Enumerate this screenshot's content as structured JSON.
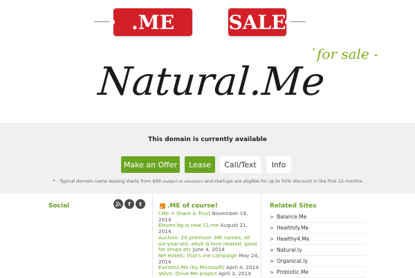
{
  "header": {
    "tags": [
      ".ME",
      "SALE"
    ],
    "domain": "Natural.Me",
    "for_sale": "for sale"
  },
  "offer": {
    "status": "This domain is currently available",
    "buttons": {
      "make_offer": "Make an Offer",
      "lease": "Lease",
      "call": "Call/Text",
      "info": "Info"
    },
    "note_prefix": "* - Typical domain name leasing starts from $99",
    "note_small": "(subject to valuation)",
    "note_suffix": "and startups are eligible for up to 50% discount in the first 12 months"
  },
  "social": {
    "heading": "Social",
    "icons": [
      "rss-icon",
      "facebook-icon",
      "twitter-icon"
    ]
  },
  "news": {
    "heading": ".ME of course!",
    "items": [
      {
        "title": "I.Me = Share & Trust",
        "date": "November 19, 2014"
      },
      {
        "title": "Eleven.bg is now 11.me",
        "date": "August 21, 2014"
      },
      {
        "title": "Auction: 24 premium .ME names, all six-year-old, adult & love related, good for shops etc",
        "date": "June 4, 2014"
      },
      {
        "title": "NH Hotels: that's me campaign",
        "date": "May 24, 2014"
      },
      {
        "title": "Eventful.Me (by Microsoft)",
        "date": "April 4, 2014"
      },
      {
        "title": "Volvo: Drive Me project",
        "date": "April 3, 2014"
      }
    ]
  },
  "related": {
    "heading": "Related Sites",
    "items": [
      "Balance.Me",
      "Healthify.Me",
      "Healthy4.Me",
      "Natural.ly",
      "Organical.ly",
      "Probiotic.Me"
    ]
  },
  "colors": {
    "accent_green": "#6aa522",
    "tag_red": "#d31f27",
    "band_gray": "#f0f0f0"
  }
}
